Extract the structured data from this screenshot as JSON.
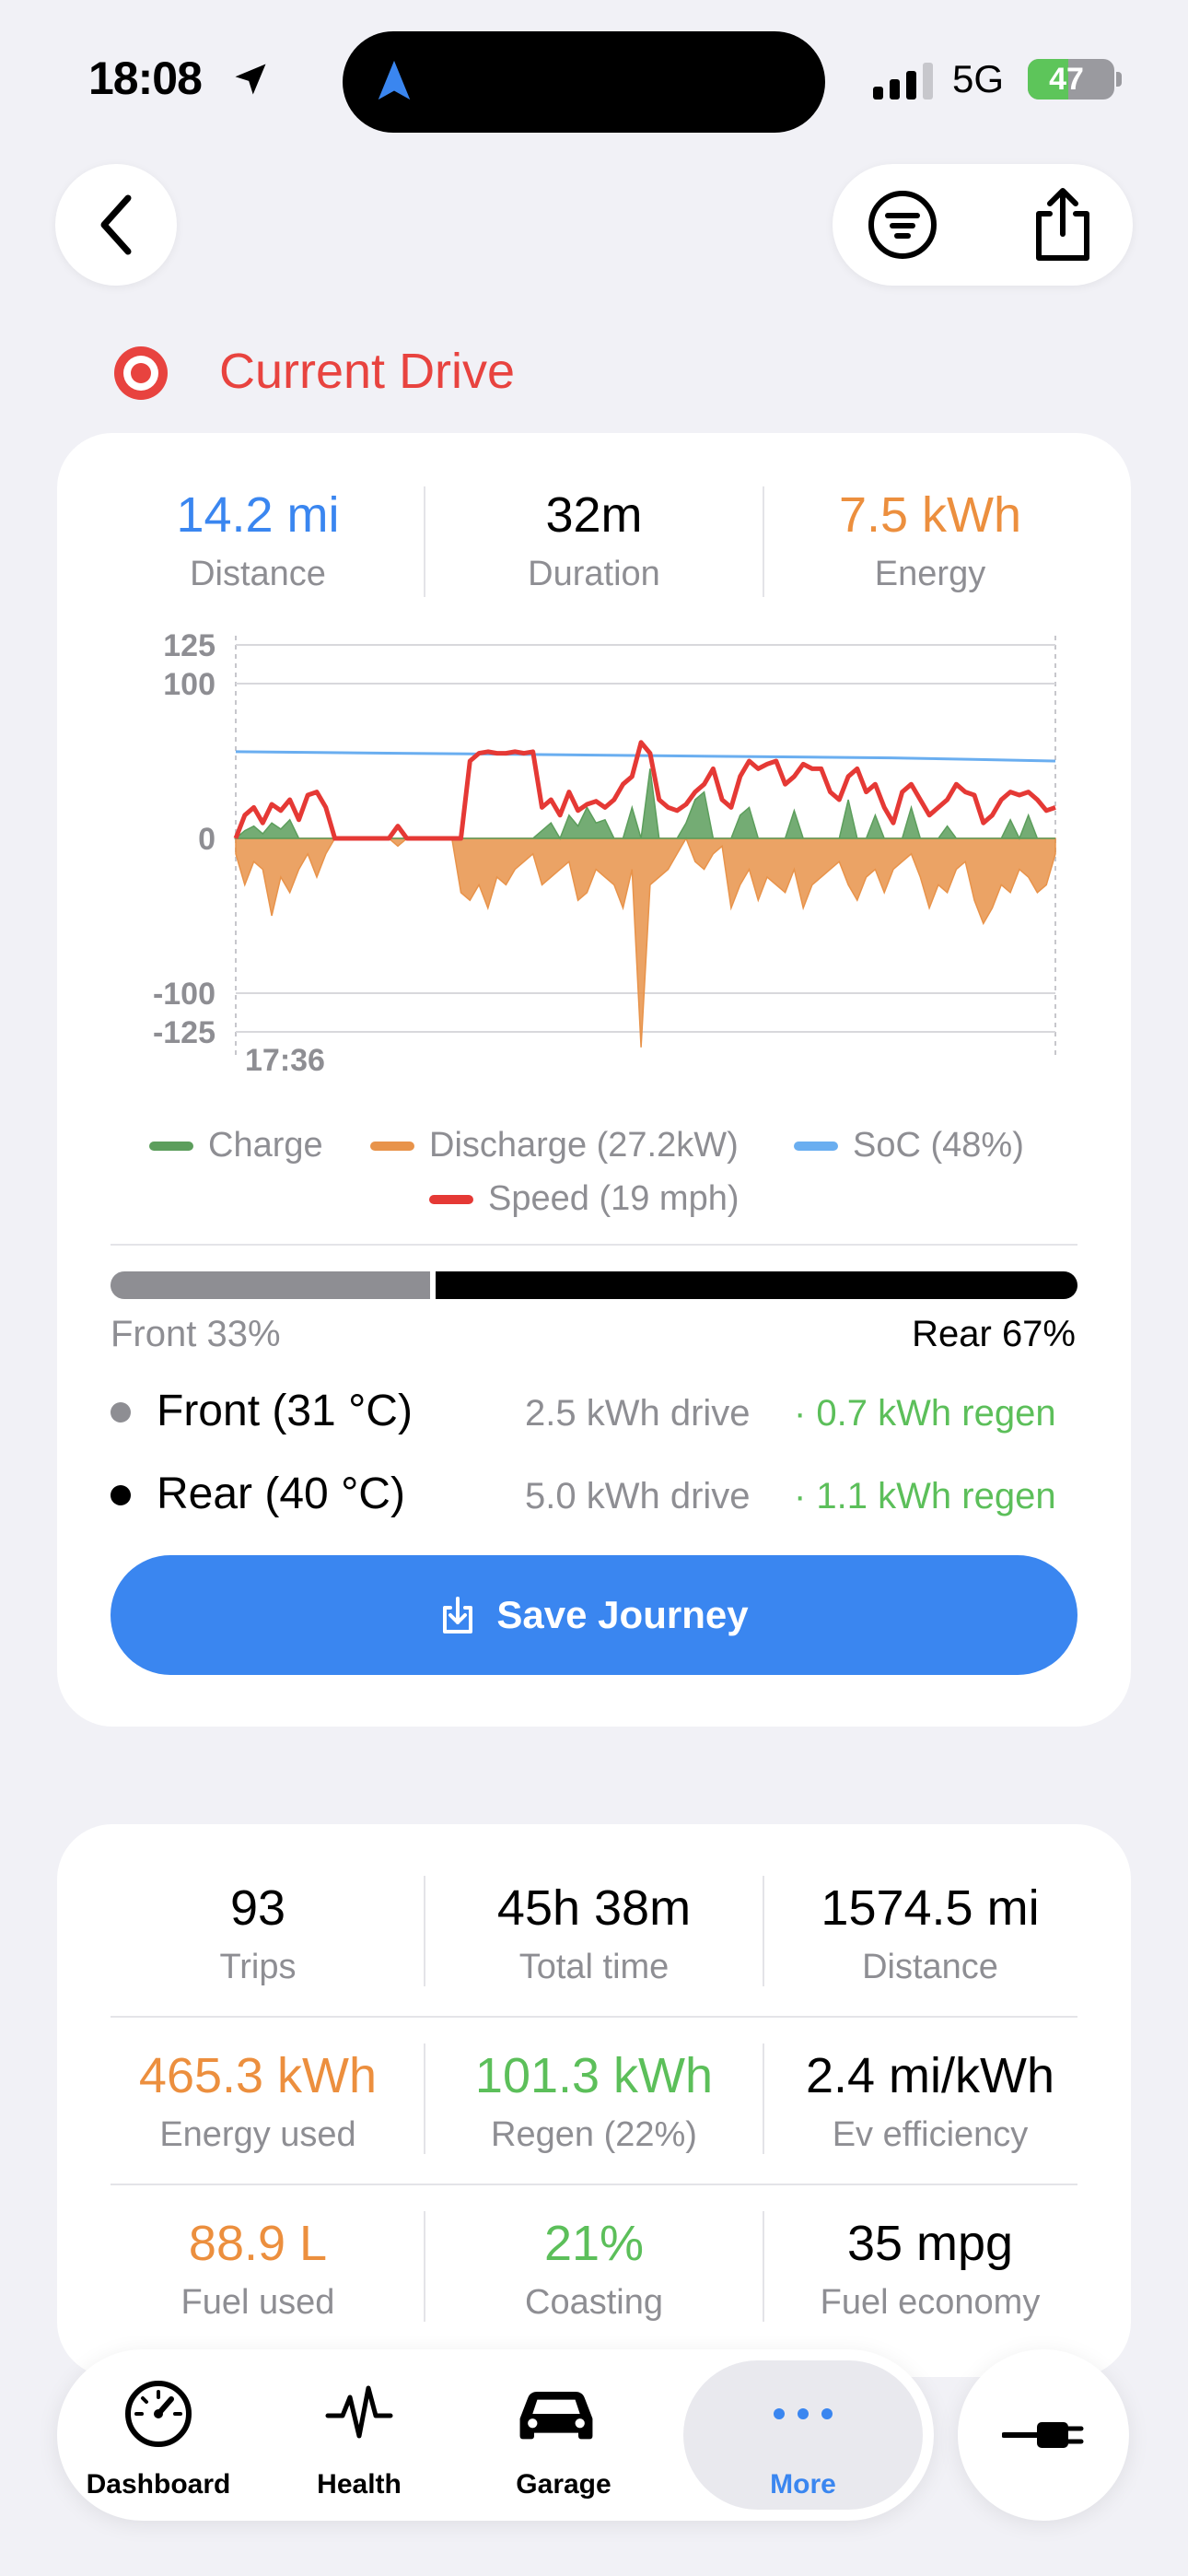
{
  "status": {
    "time": "18:08",
    "network": "5G",
    "battery": "47",
    "battery_level": 0.47
  },
  "header": {
    "section_title": "Current Drive"
  },
  "current_drive": {
    "distance": {
      "value": "14.2 mi",
      "label": "Distance"
    },
    "duration": {
      "value": "32m",
      "label": "Duration"
    },
    "energy": {
      "value": "7.5 kWh",
      "label": "Energy"
    },
    "legend": {
      "charge": "Charge",
      "discharge": "Discharge (27.2kW)",
      "soc": "SoC (48%)",
      "speed": "Speed (19 mph)"
    },
    "split": {
      "front_label": "Front 33%",
      "rear_label": "Rear 67%",
      "front_fraction": 0.33
    },
    "motors": [
      {
        "name": "Front (31 °C)",
        "drive": "2.5 kWh drive",
        "regen": "· 0.7 kWh regen",
        "dot": "#8e8e93"
      },
      {
        "name": "Rear (40 °C)",
        "drive": "5.0 kWh drive",
        "regen": "· 1.1 kWh regen",
        "dot": "#000000"
      }
    ],
    "save_label": "Save Journey"
  },
  "chart_data": {
    "type": "area",
    "y_ticks": [
      "125",
      "100",
      "0",
      "-100",
      "-125"
    ],
    "ylim": [
      -125,
      125
    ],
    "x_start_label": "17:36",
    "series": [
      {
        "name": "Speed (19 mph)",
        "color": "#e53935",
        "values": [
          0,
          15,
          20,
          10,
          22,
          18,
          25,
          12,
          28,
          30,
          20,
          0,
          0,
          0,
          0,
          0,
          0,
          0,
          8,
          0,
          0,
          0,
          0,
          0,
          0,
          0,
          50,
          55,
          56,
          55,
          55,
          56,
          55,
          56,
          20,
          25,
          15,
          30,
          18,
          22,
          24,
          20,
          25,
          35,
          40,
          62,
          55,
          25,
          20,
          18,
          22,
          30,
          35,
          45,
          25,
          20,
          40,
          50,
          45,
          48,
          50,
          35,
          40,
          48,
          45,
          45,
          30,
          25,
          40,
          45,
          30,
          35,
          20,
          10,
          30,
          35,
          25,
          15,
          20,
          25,
          35,
          30,
          28,
          10,
          15,
          25,
          30,
          28,
          30,
          25,
          18,
          20
        ]
      },
      {
        "name": "Charge",
        "color": "#5c9e5c",
        "values": [
          0,
          5,
          8,
          3,
          10,
          6,
          12,
          0,
          0,
          0,
          0,
          0,
          0,
          0,
          0,
          0,
          0,
          0,
          0,
          0,
          0,
          0,
          0,
          0,
          0,
          0,
          0,
          0,
          0,
          0,
          0,
          0,
          0,
          0,
          5,
          10,
          0,
          15,
          8,
          20,
          10,
          12,
          0,
          0,
          20,
          0,
          45,
          0,
          0,
          0,
          10,
          25,
          30,
          0,
          0,
          0,
          15,
          20,
          0,
          0,
          0,
          0,
          18,
          0,
          0,
          0,
          0,
          0,
          25,
          0,
          0,
          15,
          0,
          0,
          0,
          20,
          0,
          0,
          0,
          8,
          0,
          0,
          0,
          0,
          0,
          0,
          12,
          0,
          15,
          0,
          0,
          0
        ]
      },
      {
        "name": "Discharge (27.2kW)",
        "color": "#e8934a",
        "values": [
          -10,
          -30,
          -15,
          -20,
          -50,
          -25,
          -35,
          -20,
          -10,
          -25,
          -10,
          0,
          0,
          0,
          0,
          0,
          0,
          0,
          -5,
          0,
          0,
          0,
          0,
          0,
          0,
          -35,
          -40,
          -30,
          -45,
          -25,
          -30,
          -20,
          -15,
          -10,
          -30,
          -25,
          -20,
          -15,
          -40,
          -35,
          -20,
          -25,
          -30,
          -45,
          -20,
          -135,
          -30,
          -25,
          -20,
          -10,
          0,
          -15,
          -20,
          -10,
          -5,
          -45,
          -30,
          -20,
          -40,
          -25,
          -30,
          -35,
          -20,
          -45,
          -30,
          -25,
          -20,
          -15,
          -30,
          -40,
          -25,
          -20,
          -35,
          -20,
          -15,
          -10,
          -25,
          -45,
          -30,
          -35,
          -20,
          -15,
          -40,
          -55,
          -45,
          -30,
          -35,
          -20,
          -25,
          -35,
          -30,
          -10
        ]
      },
      {
        "name": "SoC (48%)",
        "color": "#6aaef0",
        "values": [
          56,
          55.5,
          55,
          54.5,
          54,
          53.5,
          53,
          52.5,
          52,
          51,
          50
        ]
      }
    ]
  },
  "totals": {
    "trips": {
      "value": "93",
      "label": "Trips"
    },
    "total_time": {
      "value": "45h 38m",
      "label": "Total time"
    },
    "distance": {
      "value": "1574.5 mi",
      "label": "Distance"
    },
    "energy_used": {
      "value": "465.3 kWh",
      "label": "Energy used"
    },
    "regen": {
      "value": "101.3 kWh",
      "label": "Regen (22%)"
    },
    "efficiency": {
      "value": "2.4 mi/kWh",
      "label": "Ev efficiency"
    },
    "fuel_used": {
      "value": "88.9 L",
      "label": "Fuel used"
    },
    "coasting": {
      "value": "21%",
      "label": "Coasting"
    },
    "fuel_economy": {
      "value": "35 mpg",
      "label": "Fuel economy"
    }
  },
  "tabbar": {
    "tabs": [
      {
        "label": "Dashboard",
        "icon": "speedometer-icon"
      },
      {
        "label": "Health",
        "icon": "pulse-icon"
      },
      {
        "label": "Garage",
        "icon": "car-icon"
      },
      {
        "label": "More",
        "icon": "more-icon"
      }
    ]
  },
  "colors": {
    "blue": "#3a86f0",
    "orange": "#ec8f3e",
    "green": "#5cbf5a",
    "red": "#e8433f",
    "gray": "#8e8e93"
  }
}
